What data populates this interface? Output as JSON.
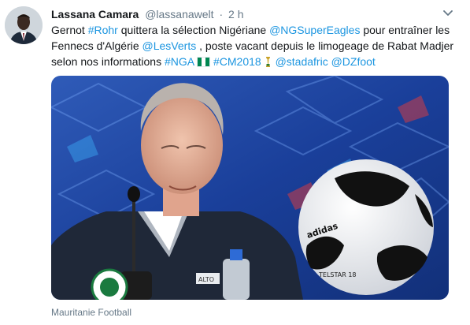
{
  "author": {
    "name": "Lassana Camara",
    "handle": "@lassanawelt",
    "separator": "·",
    "time": "2 h"
  },
  "tweet": {
    "seg1": "Gernot ",
    "rohr": "#Rohr",
    "seg2": " quittera la sélection Nigériane ",
    "superEagles": "@NGSuperEagles",
    "seg3": " pour entraîner les Fennecs d'Algérie ",
    "lesVerts": "@LesVerts",
    "seg4": " , poste vacant depuis le limogeage de Rabat Madjer selon nos informations ",
    "nga": "#NGA",
    "cm2018": "#CM2018",
    "stadafric": "@stadafric",
    "dzfoot": "@DZfoot"
  },
  "media": {
    "caption": "Mauritanie Football",
    "badge_text": "ALTO",
    "ball_brand": "adidas",
    "ball_text": "TELSTAR 18"
  },
  "icons": {
    "caret": "chevron-down-icon",
    "flag": "nigeria-flag-icon",
    "trophy": "world-cup-trophy-icon"
  },
  "colors": {
    "link": "#1b95e0",
    "muted": "#657786",
    "text": "#14171a",
    "media_background": "#1a3f9a",
    "flag_green": "#008751"
  }
}
